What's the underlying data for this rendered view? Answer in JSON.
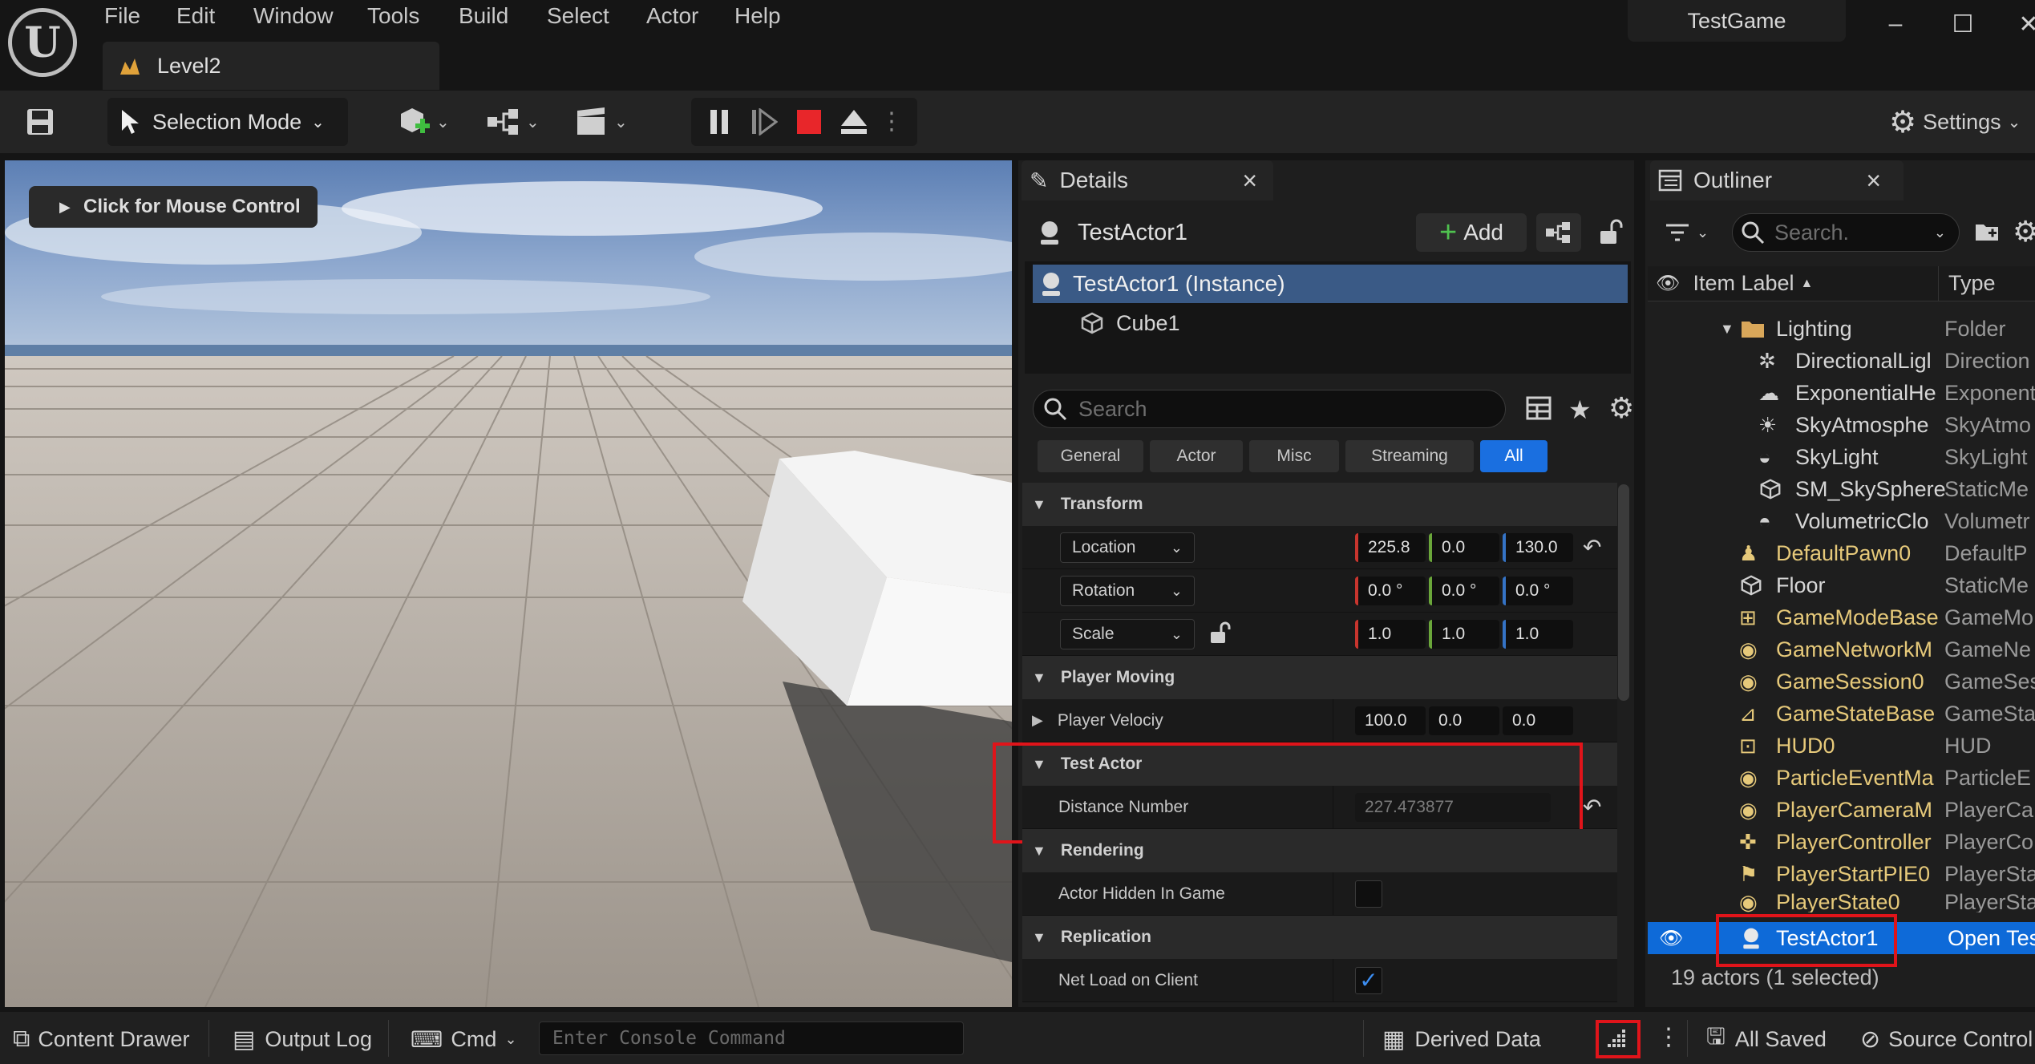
{
  "titlebar": {
    "menu": [
      "File",
      "Edit",
      "Window",
      "Tools",
      "Build",
      "Select",
      "Actor",
      "Help"
    ],
    "level_tab": "Level2",
    "project": "TestGame",
    "window_buttons": [
      "–",
      "☐",
      "✕"
    ]
  },
  "toolbar": {
    "selection_mode": "Selection Mode",
    "settings": "Settings"
  },
  "viewport": {
    "mouse_control": "Click for Mouse Control"
  },
  "details": {
    "tab_label": "Details",
    "close": "×",
    "actor_name": "TestActor1",
    "add_label": "Add",
    "instance_label": "TestActor1 (Instance)",
    "component": "Cube1",
    "search_placeholder": "Search",
    "filters": [
      "General",
      "Actor",
      "Misc",
      "Streaming",
      "All"
    ],
    "transform": {
      "header": "Transform",
      "location_label": "Location",
      "location": [
        "225.8",
        "0.0",
        "130.0"
      ],
      "rotation_label": "Rotation",
      "rotation": [
        "0.0 °",
        "0.0 °",
        "0.0 °"
      ],
      "scale_label": "Scale",
      "scale": [
        "1.0",
        "1.0",
        "1.0"
      ]
    },
    "player_moving": {
      "header": "Player Moving",
      "velocity_label": "Player Velociy",
      "velocity": [
        "100.0",
        "0.0",
        "0.0"
      ]
    },
    "test_actor": {
      "header": "Test Actor",
      "distance_label": "Distance Number",
      "distance_value": "227.473877"
    },
    "rendering": {
      "header": "Rendering",
      "hidden_label": "Actor Hidden In Game"
    },
    "replication": {
      "header": "Replication",
      "netload_label": "Net Load on Client"
    }
  },
  "outliner": {
    "tab_label": "Outliner",
    "close": "×",
    "search_placeholder": "Search.",
    "col_label": "Item Label",
    "col_type": "Type",
    "rows": [
      {
        "name": "Lighting",
        "type": "Folder"
      },
      {
        "name": "DirectionalLigl",
        "type": "Direction"
      },
      {
        "name": "ExponentialHe",
        "type": "Exponent"
      },
      {
        "name": "SkyAtmosphe",
        "type": "SkyAtmo"
      },
      {
        "name": "SkyLight",
        "type": "SkyLight"
      },
      {
        "name": "SM_SkySphere",
        "type": "StaticMe"
      },
      {
        "name": "VolumetricClo",
        "type": "Volumetr"
      },
      {
        "name": "DefaultPawn0",
        "type": "DefaultP"
      },
      {
        "name": "Floor",
        "type": "StaticMe"
      },
      {
        "name": "GameModeBase",
        "type": "GameMo"
      },
      {
        "name": "GameNetworkM",
        "type": "GameNe"
      },
      {
        "name": "GameSession0",
        "type": "GameSes"
      },
      {
        "name": "GameStateBase",
        "type": "GameSta"
      },
      {
        "name": "HUD0",
        "type": "HUD"
      },
      {
        "name": "ParticleEventMa",
        "type": "ParticleE"
      },
      {
        "name": "PlayerCameraM",
        "type": "PlayerCa"
      },
      {
        "name": "PlayerController",
        "type": "PlayerCo"
      },
      {
        "name": "PlayerStartPIE0",
        "type": "PlayerSta"
      },
      {
        "name": "PlayerState0",
        "type": "PlayerSta"
      },
      {
        "name": "TestActor1",
        "type": "Open Tes"
      }
    ],
    "footer": "19 actors (1 selected)"
  },
  "bottombar": {
    "content_drawer": "Content Drawer",
    "output_log": "Output Log",
    "cmd": "Cmd",
    "console_placeholder": "Enter Console Command",
    "derived_data": "Derived Data",
    "all_saved": "All Saved",
    "source_control": "Source Control"
  },
  "colors": {
    "accent": "#1a6fe0",
    "selected_row": "#0e6ad8",
    "highlight_box": "#e0141a",
    "actor_text": "#e6c97a"
  }
}
